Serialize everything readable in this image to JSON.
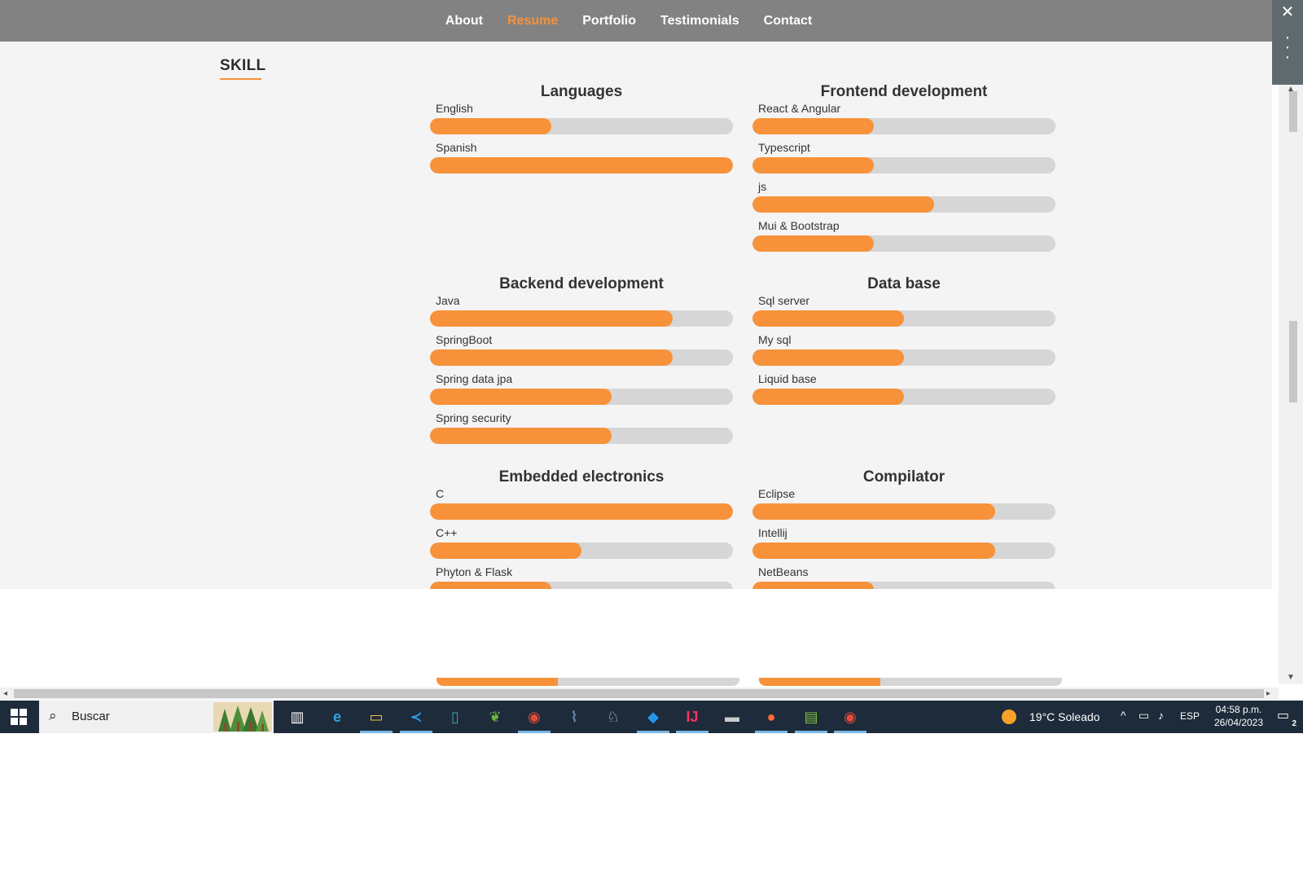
{
  "nav": {
    "items": [
      "About",
      "Resume",
      "Portfolio",
      "Testimonials",
      "Contact"
    ],
    "active": "Resume"
  },
  "section": {
    "title": "SKILL"
  },
  "colors": {
    "accent": "#f7923a",
    "track": "#d6d6d6",
    "nav_bg": "#828282",
    "taskbar": "#1e2b3a"
  },
  "groups": [
    {
      "title": "Languages",
      "skills": [
        {
          "name": "English",
          "level": 40
        },
        {
          "name": "Spanish",
          "level": 100
        }
      ]
    },
    {
      "title": "Frontend development",
      "skills": [
        {
          "name": "React & Angular",
          "level": 40
        },
        {
          "name": "Typescript",
          "level": 40
        },
        {
          "name": "js",
          "level": 60
        },
        {
          "name": "Mui & Bootstrap",
          "level": 40
        }
      ]
    },
    {
      "title": "Backend development",
      "skills": [
        {
          "name": "Java",
          "level": 80
        },
        {
          "name": "SpringBoot",
          "level": 80
        },
        {
          "name": "Spring data jpa",
          "level": 60
        },
        {
          "name": "Spring security",
          "level": 60
        }
      ]
    },
    {
      "title": "Data base",
      "skills": [
        {
          "name": "Sql server",
          "level": 50
        },
        {
          "name": "My sql",
          "level": 50
        },
        {
          "name": "Liquid base",
          "level": 50
        }
      ]
    },
    {
      "title": "Embedded electronics",
      "skills": [
        {
          "name": "C",
          "level": 100
        },
        {
          "name": "C++",
          "level": 50
        },
        {
          "name": "Phyton & Flask",
          "level": 40
        }
      ]
    },
    {
      "title": "Compilator",
      "skills": [
        {
          "name": "Eclipse",
          "level": 80
        },
        {
          "name": "Intellij",
          "level": 80
        },
        {
          "name": "NetBeans",
          "level": 40
        }
      ]
    }
  ],
  "peek_levels": [
    40,
    40
  ],
  "taskbar": {
    "search_placeholder": "Buscar",
    "apps": [
      {
        "name": "task-view-icon",
        "glyph": "▥",
        "color": "#ffffff",
        "running": false
      },
      {
        "name": "edge-icon",
        "glyph": "e",
        "color": "#2fa4e7",
        "running": false
      },
      {
        "name": "file-explorer-icon",
        "glyph": "▭",
        "color": "#f4c244",
        "running": true
      },
      {
        "name": "vscode-icon",
        "glyph": "≺",
        "color": "#2e9ae6",
        "running": true
      },
      {
        "name": "app-icon",
        "glyph": "▯",
        "color": "#3aa6b9",
        "running": false
      },
      {
        "name": "spring-tool-icon",
        "glyph": "❦",
        "color": "#6db33f",
        "running": false
      },
      {
        "name": "chrome-icon",
        "glyph": "◉",
        "color": "#e54b3a",
        "running": true
      },
      {
        "name": "mysql-workbench-icon",
        "glyph": "⌇",
        "color": "#6f8bb3",
        "running": false
      },
      {
        "name": "postgresql-icon",
        "glyph": "♘",
        "color": "#b8c7dc",
        "running": false
      },
      {
        "name": "docker-icon",
        "glyph": "◆",
        "color": "#2496ed",
        "running": true
      },
      {
        "name": "intellij-icon",
        "glyph": "IJ",
        "color": "#fe315d",
        "running": true
      },
      {
        "name": "terminal-icon",
        "glyph": "▬",
        "color": "#cccccc",
        "running": false
      },
      {
        "name": "postman-icon",
        "glyph": "●",
        "color": "#ff6c37",
        "running": true
      },
      {
        "name": "notepad-icon",
        "glyph": "▤",
        "color": "#7fc241",
        "running": true
      },
      {
        "name": "chrome-profile-icon",
        "glyph": "◉",
        "color": "#e54b3a",
        "running": true
      }
    ],
    "weather": "19°C  Soleado",
    "lang": "ESP",
    "time": "04:58 p.m.",
    "date": "26/04/2023",
    "notifications": "2"
  }
}
